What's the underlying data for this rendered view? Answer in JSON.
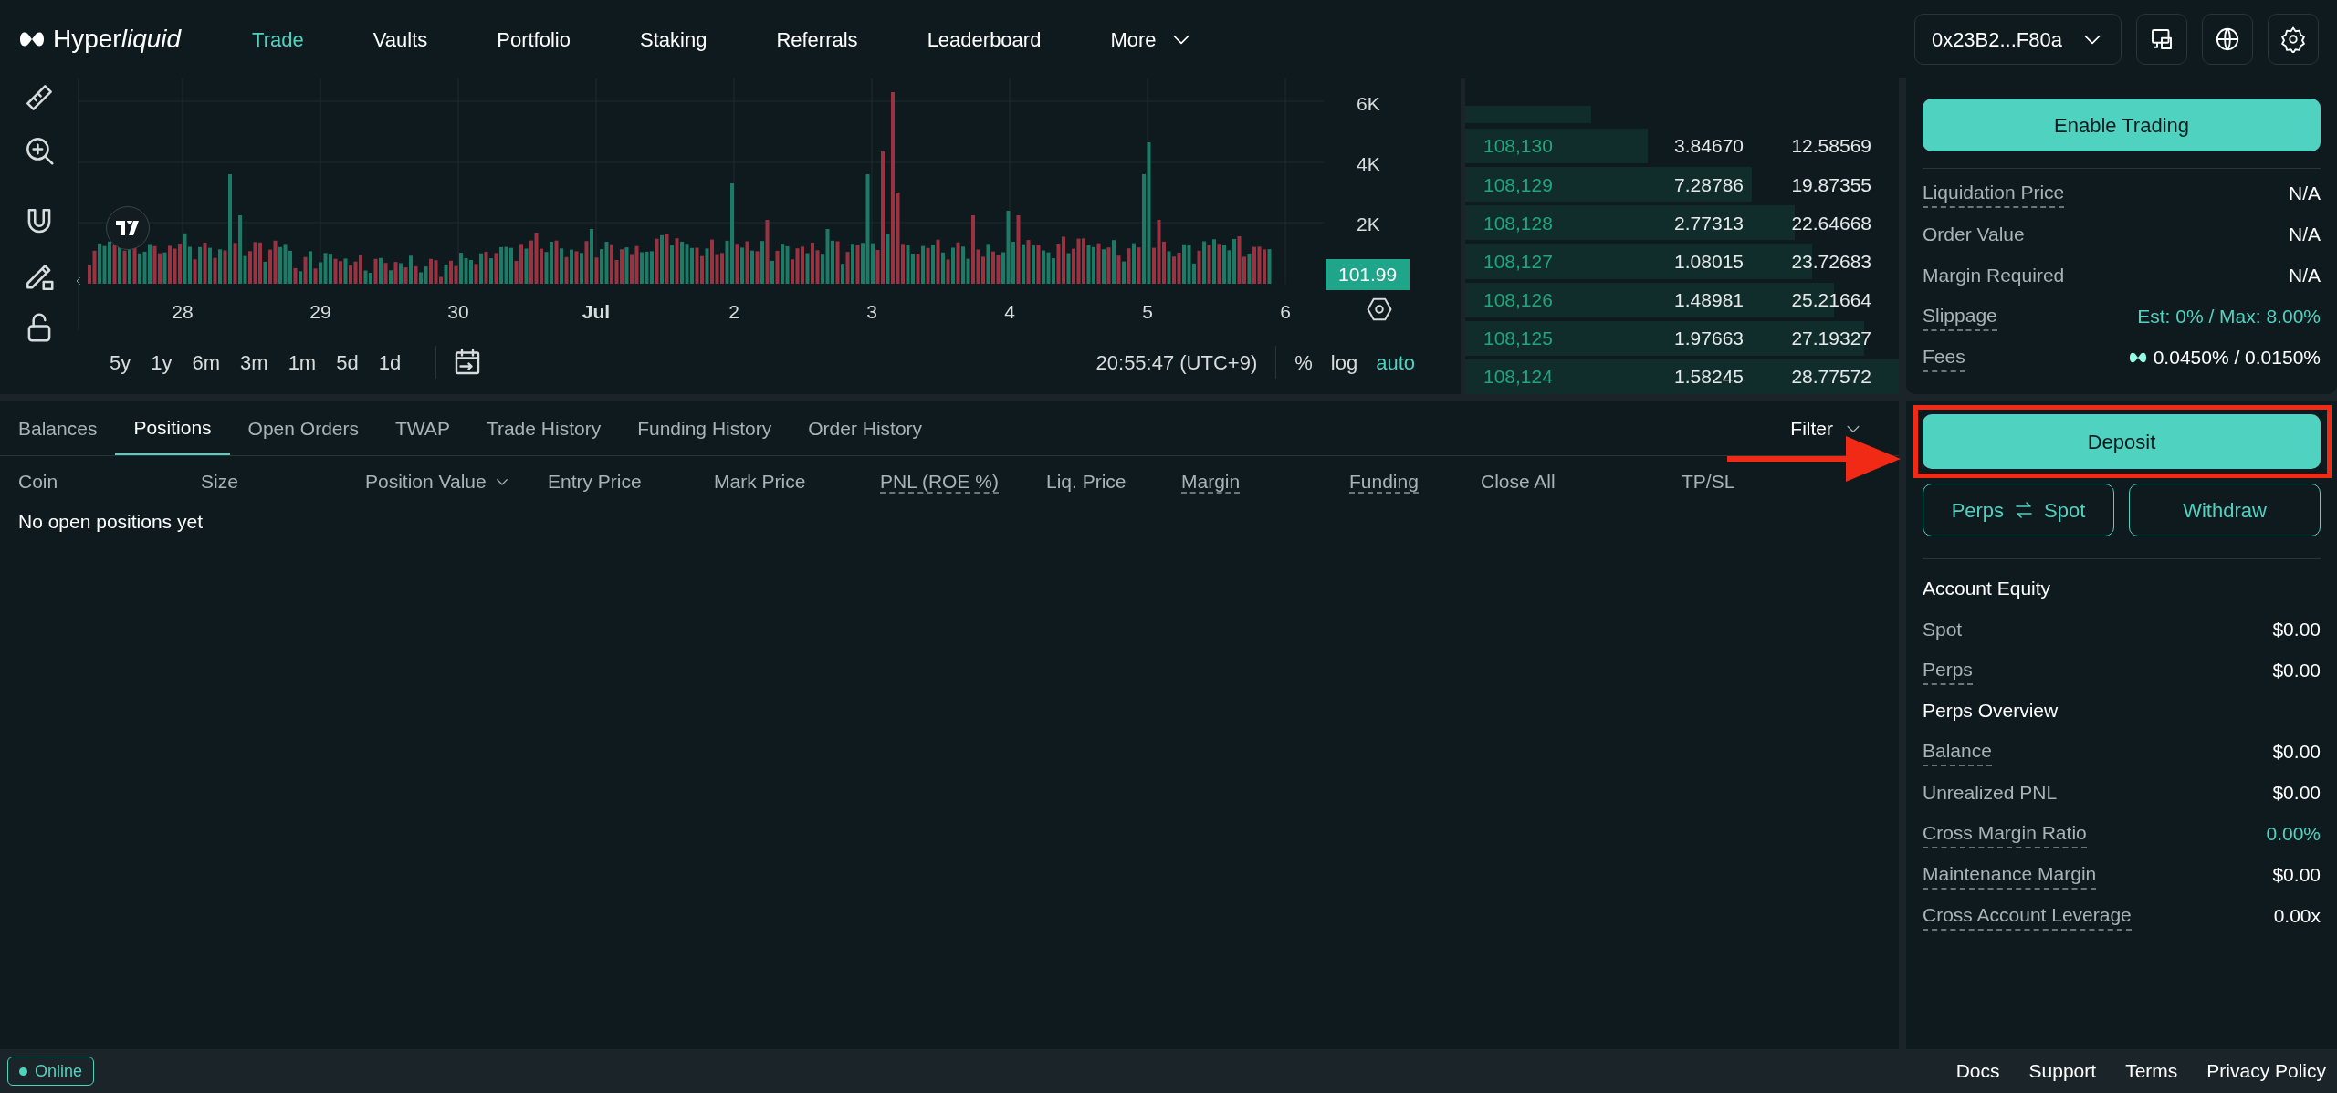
{
  "nav": {
    "logo": [
      {
        "text": "Hyper",
        "italic": false
      },
      {
        "text": "liquid",
        "italic": true
      }
    ],
    "items": [
      {
        "label": "Trade",
        "selected": true
      },
      {
        "label": "Vaults",
        "selected": false
      },
      {
        "label": "Portfolio",
        "selected": false
      },
      {
        "label": "Staking",
        "selected": false
      },
      {
        "label": "Referrals",
        "selected": false
      },
      {
        "label": "Leaderboard",
        "selected": false
      }
    ],
    "more": "More",
    "wallet": "0x23B2...F80a"
  },
  "chart": {
    "y_labels": [
      "6K",
      "4K",
      "2K"
    ],
    "last_value": "101.99",
    "x_labels": [
      {
        "label": "28",
        "bold": false
      },
      {
        "label": "29",
        "bold": false
      },
      {
        "label": "30",
        "bold": false
      },
      {
        "label": "Jul",
        "bold": true
      },
      {
        "label": "2",
        "bold": false
      },
      {
        "label": "3",
        "bold": false
      },
      {
        "label": "4",
        "bold": false
      },
      {
        "label": "5",
        "bold": false
      },
      {
        "label": "6",
        "bold": false
      }
    ],
    "ranges": [
      "5y",
      "1y",
      "6m",
      "3m",
      "1m",
      "5d",
      "1d"
    ],
    "time": "20:55:47 (UTC+9)",
    "scale_options": [
      {
        "label": "%",
        "selected": false
      },
      {
        "label": "log",
        "selected": false
      },
      {
        "label": "auto",
        "selected": true
      }
    ]
  },
  "order_book": {
    "rows": [
      {
        "price": "108,130",
        "size": "3.84670",
        "total": "12.58569",
        "level": 0.42
      },
      {
        "price": "108,129",
        "size": "7.28786",
        "total": "19.87355",
        "level": 0.66
      },
      {
        "price": "108,128",
        "size": "2.77313",
        "total": "22.64668",
        "level": 0.76
      },
      {
        "price": "108,127",
        "size": "1.08015",
        "total": "23.72683",
        "level": 0.8
      },
      {
        "price": "108,126",
        "size": "1.48981",
        "total": "25.21664",
        "level": 0.85
      },
      {
        "price": "108,125",
        "size": "1.97663",
        "total": "27.19327",
        "level": 0.92
      },
      {
        "price": "108,124",
        "size": "1.58245",
        "total": "28.77572",
        "level": 1.0
      }
    ]
  },
  "order_panel": {
    "button": "Enable Trading",
    "rows": [
      {
        "label": "Liquidation Price",
        "value": "N/A",
        "underlined": true,
        "accent": false,
        "kind": "plain"
      },
      {
        "label": "Order Value",
        "value": "N/A",
        "underlined": false,
        "accent": false,
        "kind": "plain"
      },
      {
        "label": "Margin Required",
        "value": "N/A",
        "underlined": false,
        "accent": false,
        "kind": "plain"
      },
      {
        "label": "Slippage",
        "value": "Est: 0% / Max: 8.00%",
        "underlined": true,
        "accent": true,
        "kind": "plain"
      },
      {
        "label": "Fees",
        "value": "0.0450% / 0.0150%",
        "underlined": true,
        "kind": "fees"
      }
    ]
  },
  "positions": {
    "tabs": [
      {
        "label": "Balances",
        "selected": false
      },
      {
        "label": "Positions",
        "selected": true
      },
      {
        "label": "Open Orders",
        "selected": false
      },
      {
        "label": "TWAP",
        "selected": false
      },
      {
        "label": "Trade History",
        "selected": false
      },
      {
        "label": "Funding History",
        "selected": false
      },
      {
        "label": "Order History",
        "selected": false
      }
    ],
    "filter": "Filter",
    "columns": [
      {
        "label": "Coin",
        "underlined": false,
        "sortable": false
      },
      {
        "label": "Size",
        "underlined": false,
        "sortable": false
      },
      {
        "label": "Position Value",
        "underlined": false,
        "sortable": true
      },
      {
        "label": "Entry Price",
        "underlined": false,
        "sortable": false
      },
      {
        "label": "Mark Price",
        "underlined": false,
        "sortable": false
      },
      {
        "label": "PNL (ROE %)",
        "underlined": true,
        "sortable": false
      },
      {
        "label": "Liq. Price",
        "underlined": false,
        "sortable": false
      },
      {
        "label": "Margin",
        "underlined": true,
        "sortable": false
      },
      {
        "label": "Funding",
        "underlined": true,
        "sortable": false
      },
      {
        "label": "Close All",
        "underlined": false,
        "sortable": false
      },
      {
        "label": "TP/SL",
        "underlined": false,
        "sortable": false
      }
    ],
    "empty": "No open positions yet"
  },
  "account": {
    "deposit": "Deposit",
    "transfer": {
      "left": "Perps",
      "right": "Spot"
    },
    "withdraw": "Withdraw",
    "sections": [
      {
        "title": "Account Equity",
        "rows": [
          {
            "label": "Spot",
            "value": "$0.00",
            "underlined": false,
            "accent": false
          },
          {
            "label": "Perps",
            "value": "$0.00",
            "underlined": true,
            "accent": false
          }
        ]
      },
      {
        "title": "Perps Overview",
        "rows": [
          {
            "label": "Balance",
            "value": "$0.00",
            "underlined": true,
            "accent": false
          },
          {
            "label": "Unrealized PNL",
            "value": "$0.00",
            "underlined": false,
            "accent": false
          },
          {
            "label": "Cross Margin Ratio",
            "value": "0.00%",
            "underlined": true,
            "accent": true
          },
          {
            "label": "Maintenance Margin",
            "value": "$0.00",
            "underlined": true,
            "accent": false
          },
          {
            "label": "Cross Account Leverage",
            "value": "0.00x",
            "underlined": true,
            "accent": false
          }
        ]
      }
    ]
  },
  "footer": {
    "status": "Online",
    "links": [
      "Docs",
      "Support",
      "Terms",
      "Privacy Policy"
    ]
  }
}
